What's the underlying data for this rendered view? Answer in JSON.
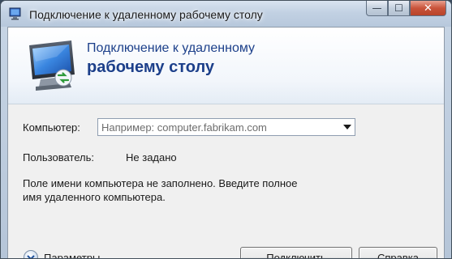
{
  "window": {
    "title": "Подключение к удаленному рабочему столу",
    "caption_buttons": {
      "minimize": "—",
      "maximize": "☐",
      "close": "✕"
    }
  },
  "header": {
    "line1": "Подключение к удаленному",
    "line2": "рабочему столу",
    "icon": "remote-desktop-monitor-icon"
  },
  "form": {
    "computer_label": "Компьютер:",
    "computer_value": "Например: computer.fabrikam.com",
    "user_label": "Пользователь:",
    "user_value": "Не задано",
    "message_line1": "Поле имени компьютера не заполнено. Введите полное",
    "message_line2": "имя удаленного компьютера."
  },
  "footer": {
    "options_label": "Параметры",
    "connect_label": "Подключить",
    "help_label": "Справка"
  },
  "colors": {
    "header_text": "#1c3f8a",
    "body_background": "#f0f0f0",
    "close_button": "#c9543b"
  }
}
